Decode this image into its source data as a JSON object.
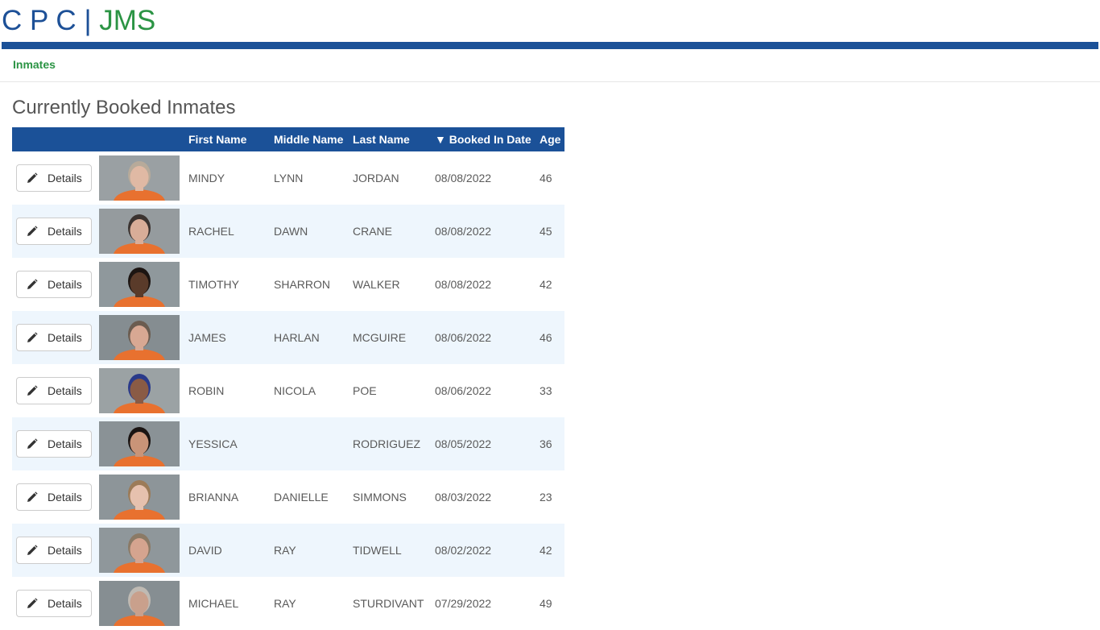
{
  "logo": {
    "part1": "C P C",
    "sep": " | ",
    "part2": "JMS"
  },
  "nav": {
    "inmates_link": "Inmates"
  },
  "page_title": "Currently Booked Inmates",
  "table": {
    "headers": {
      "first_name": "First Name",
      "middle_name": "Middle Name",
      "last_name": "Last Name",
      "booked_in_date": "▼ Booked In Date",
      "age": "Age"
    },
    "details_label": "Details",
    "rows": [
      {
        "first": "MINDY",
        "middle": "LYNN",
        "last": "JORDAN",
        "date": "08/08/2022",
        "age": "46"
      },
      {
        "first": "RACHEL",
        "middle": "DAWN",
        "last": "CRANE",
        "date": "08/08/2022",
        "age": "45"
      },
      {
        "first": "TIMOTHY",
        "middle": "SHARRON",
        "last": "WALKER",
        "date": "08/08/2022",
        "age": "42"
      },
      {
        "first": "JAMES",
        "middle": "HARLAN",
        "last": "MCGUIRE",
        "date": "08/06/2022",
        "age": "46"
      },
      {
        "first": "ROBIN",
        "middle": "NICOLA",
        "last": "POE",
        "date": "08/06/2022",
        "age": "33"
      },
      {
        "first": "YESSICA",
        "middle": "",
        "last": "RODRIGUEZ",
        "date": "08/05/2022",
        "age": "36"
      },
      {
        "first": "BRIANNA",
        "middle": "DANIELLE",
        "last": "SIMMONS",
        "date": "08/03/2022",
        "age": "23"
      },
      {
        "first": "DAVID",
        "middle": "RAY",
        "last": "TIDWELL",
        "date": "08/02/2022",
        "age": "42"
      },
      {
        "first": "MICHAEL",
        "middle": "RAY",
        "last": "STURDIVANT",
        "date": "07/29/2022",
        "age": "49"
      }
    ]
  },
  "colors": {
    "brand_blue": "#1b5198",
    "brand_green": "#2b9444",
    "row_alt": "#eef6fd"
  },
  "icons": {
    "details_button_icon": "pencil-icon"
  }
}
